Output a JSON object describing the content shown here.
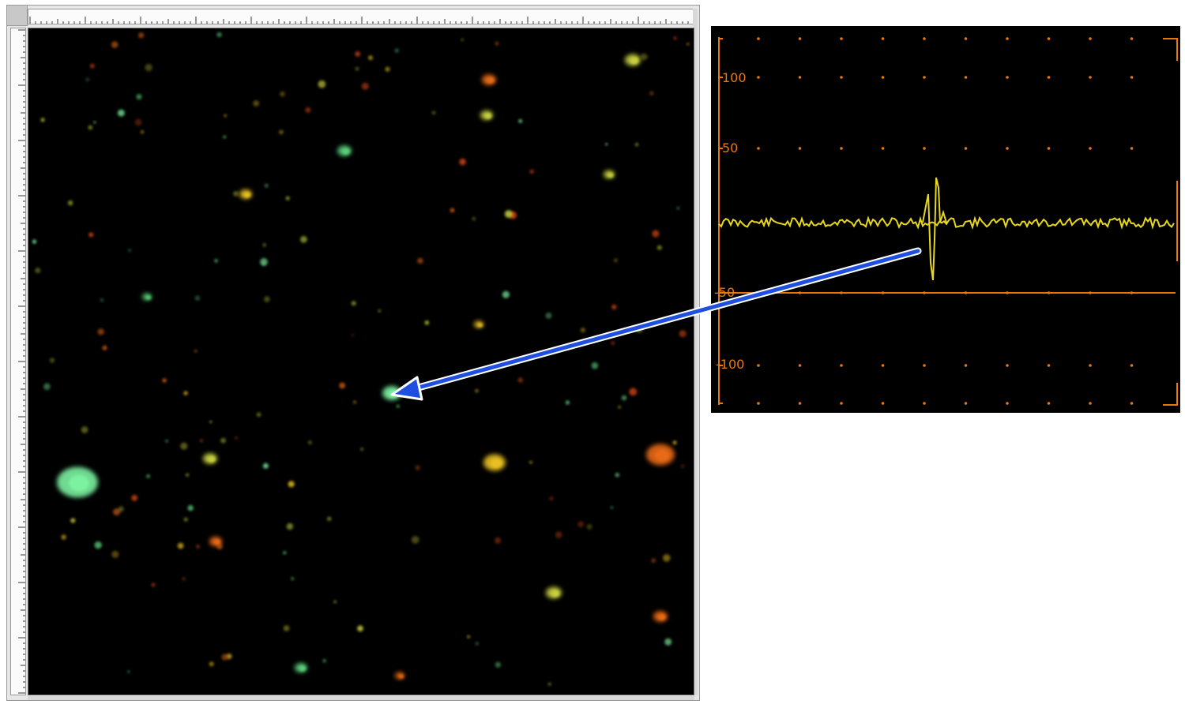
{
  "scope": {
    "y_tick_labels": [
      "100",
      "50",
      "-50",
      "-100"
    ],
    "trace_color": "#e8d81c",
    "grid_color": "#e8780c"
  },
  "colors": {
    "pointer_arrow": "#1f4fe0",
    "cell_green": "#7cf2a0",
    "cell_orange": "#e86a18",
    "cell_yellow": "#e8c020"
  },
  "icons": {
    "pointer": "arrow-icon"
  }
}
